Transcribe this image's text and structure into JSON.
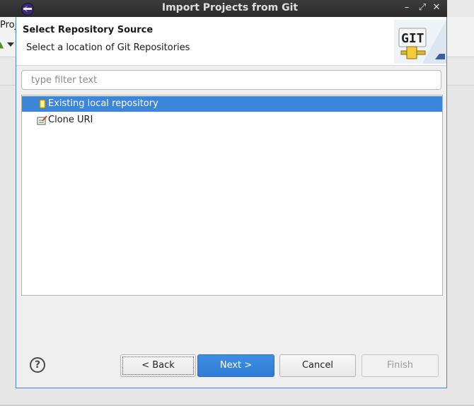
{
  "window": {
    "title": "Import Projects from Git",
    "background_menu_partial": "Proj"
  },
  "banner": {
    "title": "Select Repository Source",
    "description": "Select a location of Git Repositories",
    "logo_text": "GIT"
  },
  "filter": {
    "placeholder": "type filter text",
    "value": ""
  },
  "tree": {
    "items": [
      {
        "label": "Existing local repository",
        "icon": "repository-icon",
        "selected": true
      },
      {
        "label": "Clone URI",
        "icon": "clone-uri-icon",
        "selected": false
      }
    ]
  },
  "buttons": {
    "help": "?",
    "back": "< Back",
    "next": "Next >",
    "cancel": "Cancel",
    "finish": "Finish"
  },
  "colors": {
    "selection": "#3b86d8",
    "dialog_border": "#4a86c8",
    "titlebar": "#2b2b2b"
  }
}
